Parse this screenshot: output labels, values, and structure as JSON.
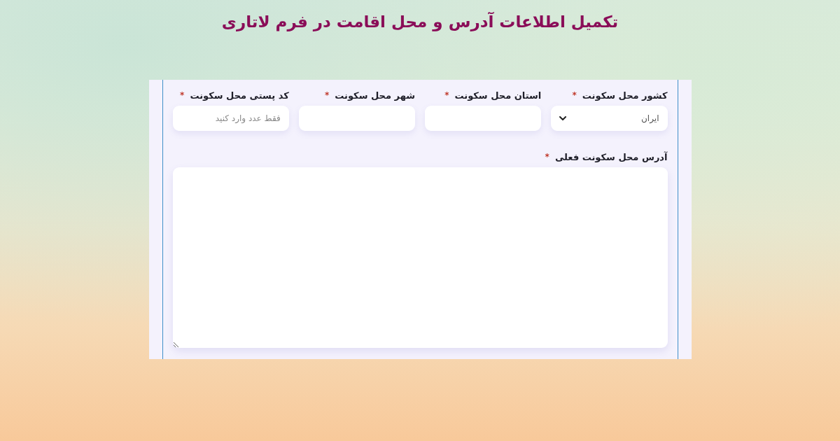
{
  "title": "تکمیل اطلاعات آدرس و محل اقامت در فرم لاتاری",
  "fields": [
    {
      "kind": "select",
      "label": "کشور محل سکونت",
      "required_mark": "*",
      "value": "ایران"
    },
    {
      "kind": "text",
      "label": "استان محل سکونت",
      "required_mark": "*"
    },
    {
      "kind": "text",
      "label": "شهر محل سکونت",
      "required_mark": "*"
    },
    {
      "kind": "text",
      "label": "کد پستی محل سکونت",
      "required_mark": "*",
      "placeholder": "فقط عدد وارد کنید"
    }
  ],
  "address": {
    "label": "آدرس محل سکونت فعلی",
    "required_mark": "*"
  }
}
